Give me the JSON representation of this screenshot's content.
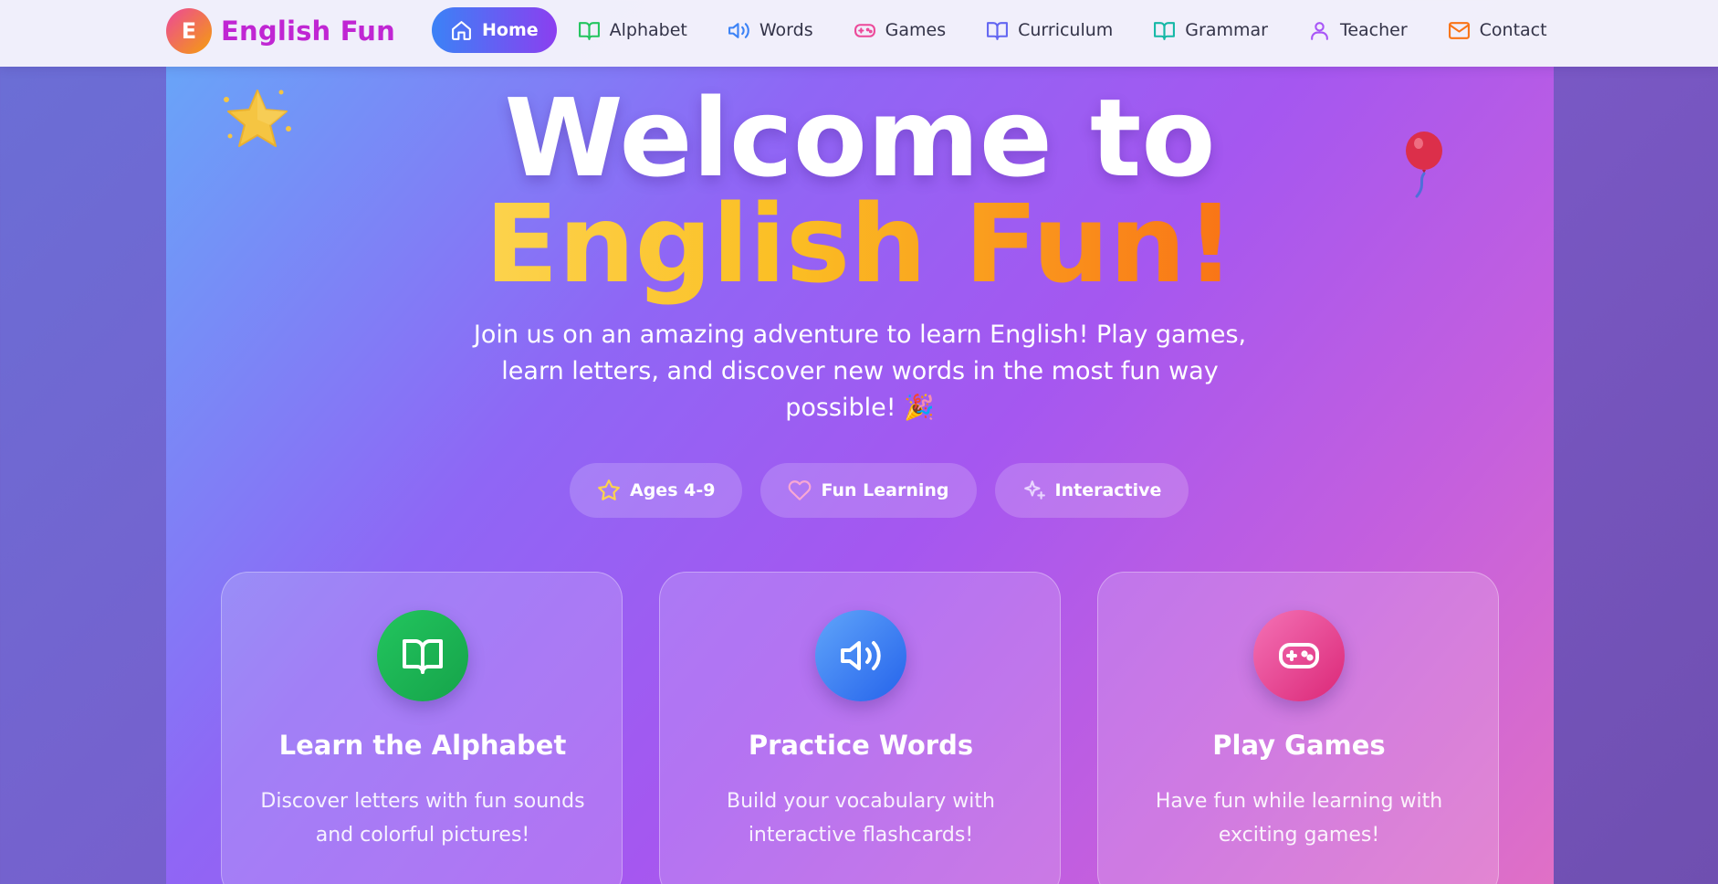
{
  "brand": {
    "logo_letter": "E",
    "name": "English Fun"
  },
  "nav": {
    "items": [
      {
        "label": "Home",
        "icon": "home-icon",
        "color": "#ffffff",
        "active": true
      },
      {
        "label": "Alphabet",
        "icon": "book-open-icon",
        "color": "#22c55e"
      },
      {
        "label": "Words",
        "icon": "volume-icon",
        "color": "#3b82f6"
      },
      {
        "label": "Games",
        "icon": "gamepad-icon",
        "color": "#ec4899"
      },
      {
        "label": "Curriculum",
        "icon": "book-open-icon",
        "color": "#6366f1"
      },
      {
        "label": "Grammar",
        "icon": "book-open-icon",
        "color": "#14b8a6"
      },
      {
        "label": "Teacher",
        "icon": "user-icon",
        "color": "#a855f7"
      },
      {
        "label": "Contact",
        "icon": "mail-icon",
        "color": "#f97316"
      }
    ]
  },
  "hero": {
    "title_line1": "Welcome to",
    "title_line2": "English Fun!",
    "subtitle": "Join us on an amazing adventure to learn English! Play games, learn letters, and discover new words in the most fun way possible! 🎉",
    "badges": [
      {
        "label": "Ages 4-9",
        "icon": "star-icon",
        "color": "#fcd34d"
      },
      {
        "label": "Fun Learning",
        "icon": "heart-icon",
        "color": "#f9a8d4"
      },
      {
        "label": "Interactive",
        "icon": "sparkles-icon",
        "color": "#e9d5ff"
      }
    ]
  },
  "cards": [
    {
      "title": "Learn the Alphabet",
      "description": "Discover letters with fun sounds and colorful pictures!",
      "icon": "book-open-icon",
      "color_from": "#22c55e",
      "color_to": "#16a34a"
    },
    {
      "title": "Practice Words",
      "description": "Build your vocabulary with interactive flashcards!",
      "icon": "volume-icon",
      "color_from": "#60a5fa",
      "color_to": "#2563eb"
    },
    {
      "title": "Play Games",
      "description": "Have fun while learning with exciting games!",
      "icon": "gamepad-icon",
      "color_from": "#f472b6",
      "color_to": "#db2777"
    }
  ],
  "decorations": {
    "star": "star-decoration",
    "balloon": "balloon-decoration"
  }
}
